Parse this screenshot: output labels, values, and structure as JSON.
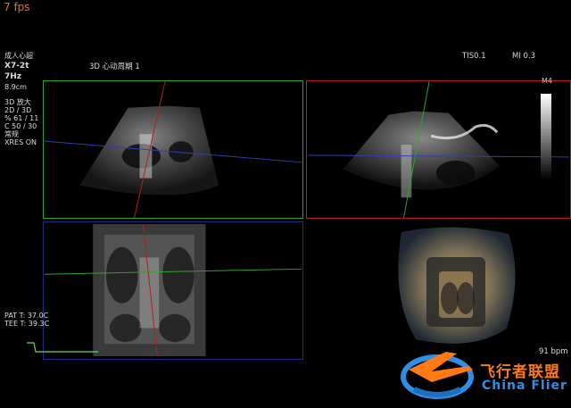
{
  "top": {
    "fps": "7 fps"
  },
  "header": {
    "preset": "成人心超",
    "probe": "X7-2t",
    "freq": "7Hz",
    "depth": "8.9cm",
    "mode_title": "3D 心动周期 1",
    "tis": "TIS0.1",
    "mi": "MI 0.3"
  },
  "params": {
    "title": "3D 放大",
    "line1": "2D / 3D",
    "line2": "% 61 / 11",
    "line3": "C 50 / 30",
    "line4": "常规",
    "line5": "XRES ON"
  },
  "scale": {
    "label": "M4"
  },
  "footer": {
    "pat_temp": "PAT T: 37.0C",
    "tee_temp": "TEE T: 39.3C",
    "heart_rate": "91 bpm"
  },
  "watermark": {
    "cn": "飞行者联盟",
    "en": "China Flier"
  },
  "colors": {
    "panel_green": "#2aa62a",
    "panel_red": "#b41e1e",
    "panel_blue": "#1e2a8a",
    "fps_orange": "#ff6a1a",
    "wm_orange": "#ff7a14",
    "wm_blue": "#2f8fe6"
  }
}
